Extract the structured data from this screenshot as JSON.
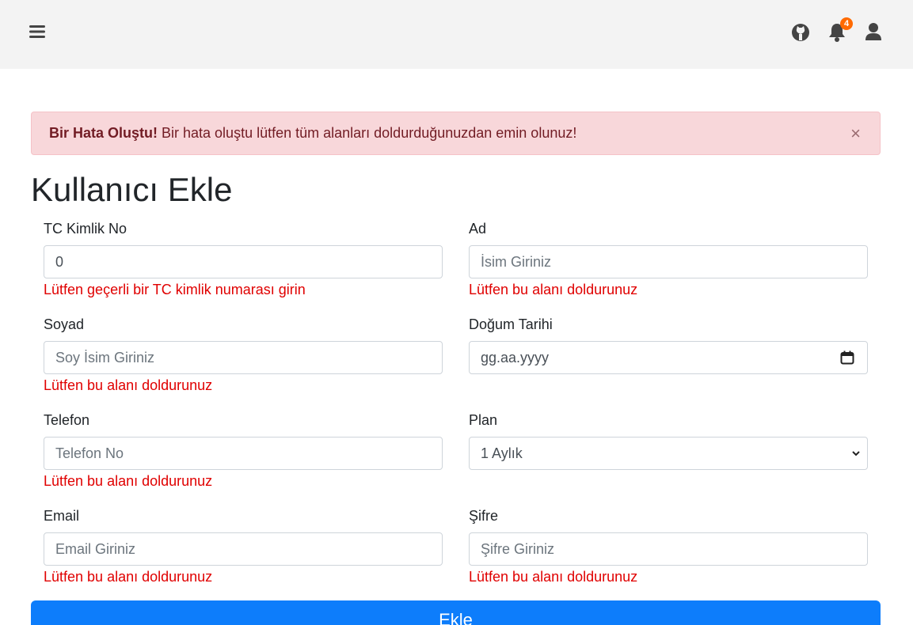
{
  "header": {
    "notification_count": "4"
  },
  "alert": {
    "title": "Bir Hata Oluştu!",
    "message": " Bir hata oluştu lütfen tüm alanları doldurduğunuzdan emin olunuz!",
    "close_symbol": "×"
  },
  "page": {
    "title": "Kullanıcı Ekle"
  },
  "form": {
    "tc": {
      "label": "TC Kimlik No",
      "value": "0",
      "error": "Lütfen geçerli bir TC kimlik numarası girin"
    },
    "ad": {
      "label": "Ad",
      "placeholder": "İsim Giriniz",
      "error": "Lütfen bu alanı doldurunuz"
    },
    "soyad": {
      "label": "Soyad",
      "placeholder": "Soy İsim Giriniz",
      "error": "Lütfen bu alanı doldurunuz"
    },
    "dogum": {
      "label": "Doğum Tarihi",
      "placeholder": "gg.aa.yyyy"
    },
    "telefon": {
      "label": "Telefon",
      "placeholder": "Telefon No",
      "error": "Lütfen bu alanı doldurunuz"
    },
    "plan": {
      "label": "Plan",
      "selected": "1 Aylık"
    },
    "email": {
      "label": "Email",
      "placeholder": "Email Giriniz",
      "error": "Lütfen bu alanı doldurunuz"
    },
    "sifre": {
      "label": "Şifre",
      "placeholder": "Şifre Giriniz",
      "error": "Lütfen bu alanı doldurunuz"
    },
    "submit_label": "Ekle"
  },
  "colors": {
    "accent": "#0d7dfb",
    "error": "#e00000",
    "alert_bg": "#f8d7da",
    "badge": "#ff6a00"
  },
  "icons": [
    "menu-icon",
    "github-icon",
    "bell-icon",
    "user-icon",
    "close-icon",
    "calendar-icon",
    "chevron-down-icon"
  ]
}
